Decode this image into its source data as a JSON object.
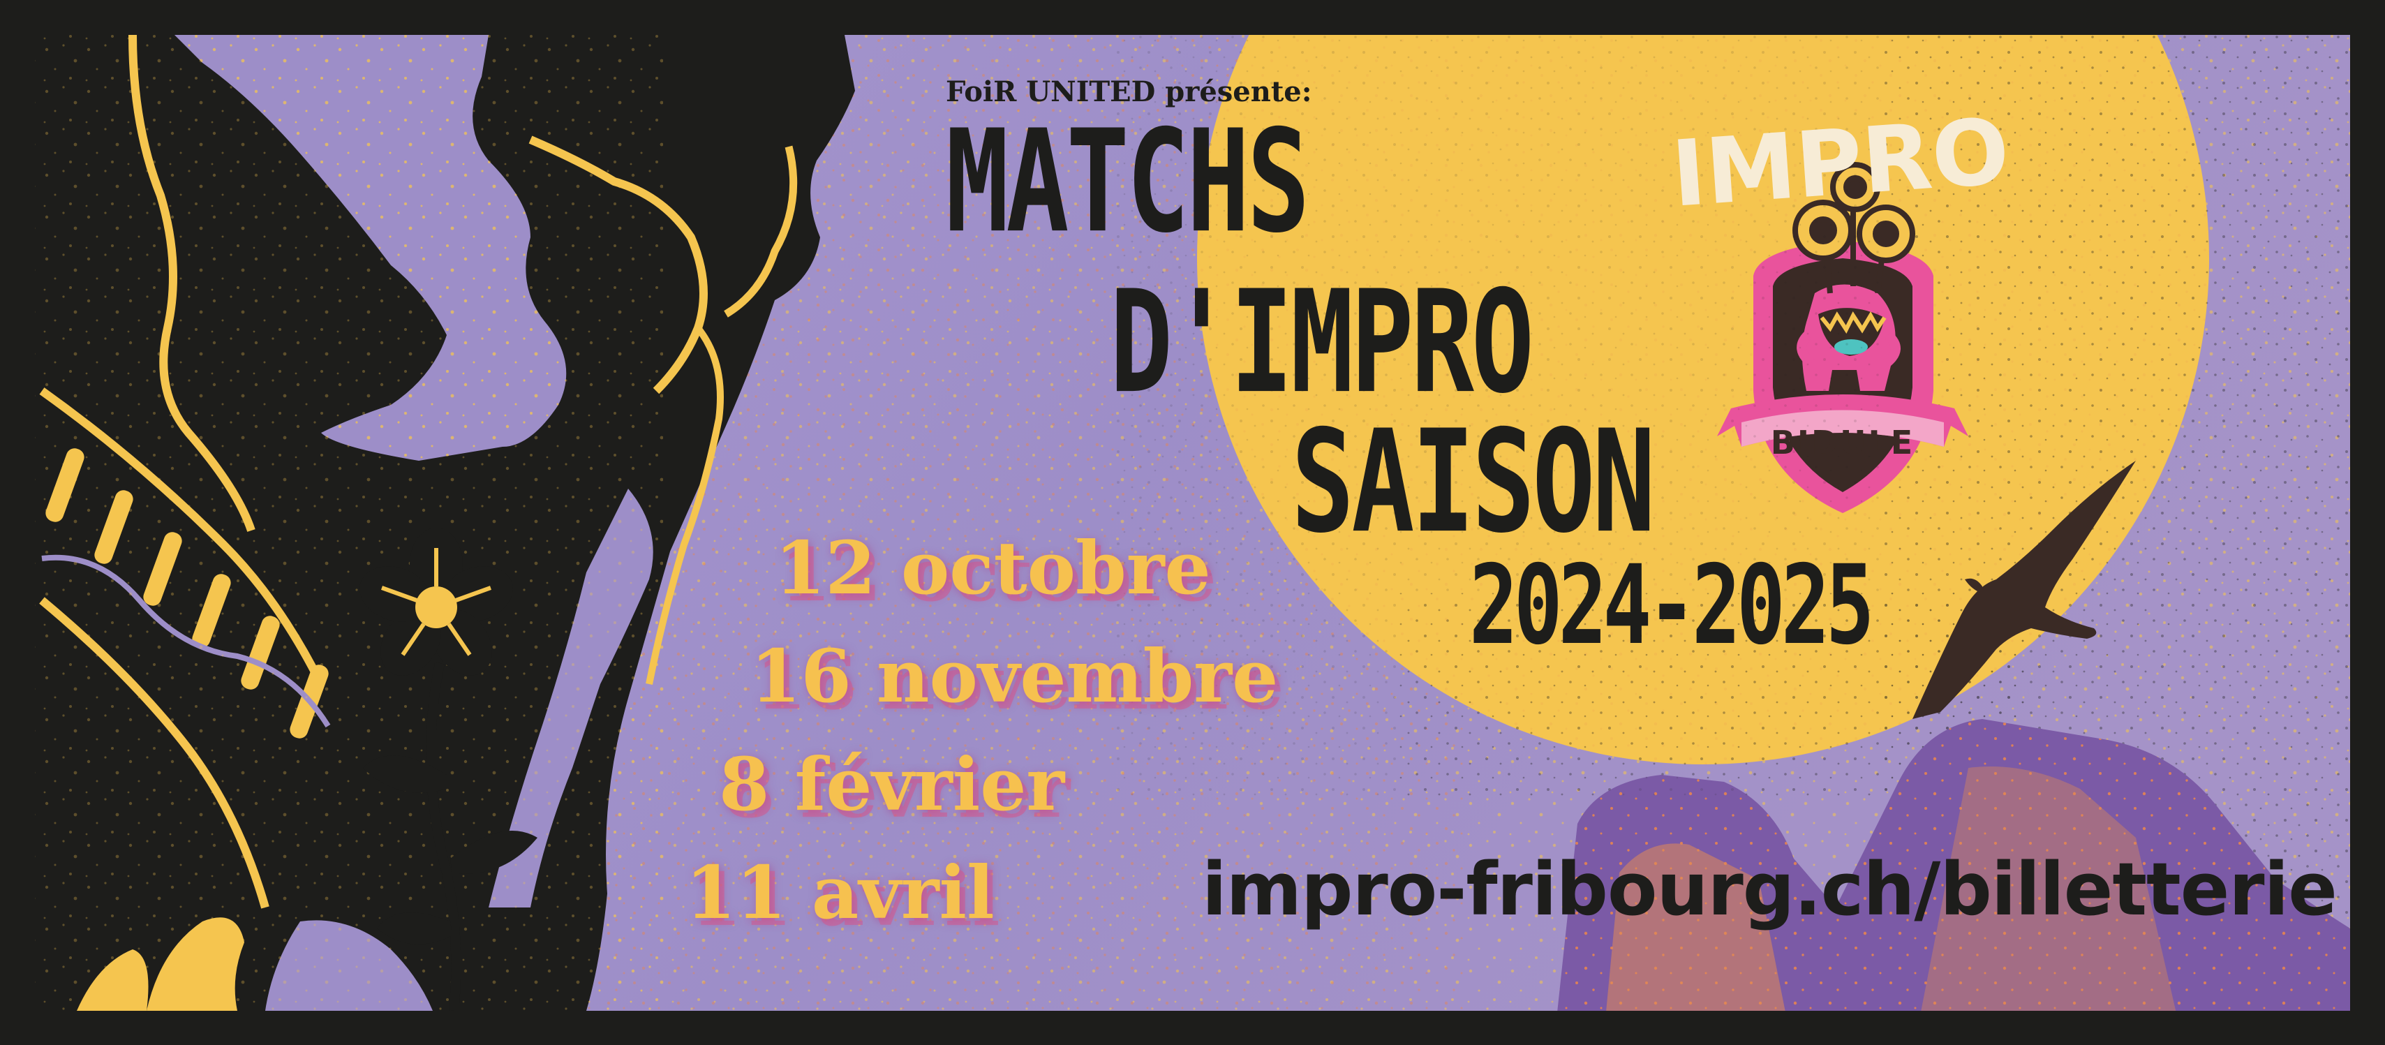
{
  "poster": {
    "presenter": "FoiR UNITED présente:",
    "title_lines": [
      "MATCHS",
      "D'IMPRO",
      "SAISON"
    ],
    "season": "2024-2025",
    "dates": [
      "12 octobre",
      "16 novembre",
      "8 février",
      "11 avril"
    ],
    "url": "impro-fribourg.ch/billetterie"
  },
  "logo": {
    "top_text": "IMPRO",
    "banner_text": "BIDULE"
  },
  "colors": {
    "background_lavender": "#9e8fc9",
    "sun_yellow": "#f5c54f",
    "ink_black": "#1d1d1b",
    "date_yellow": "#f6c14f",
    "date_shadow_pink": "#d4568c",
    "mountain_purple": "#7b5aa6",
    "mountain_orange": "#e28a55",
    "logo_pink": "#e9539c",
    "logo_cream": "#f7ecd6"
  },
  "decor": {
    "silhouette": "cowboy-silhouette",
    "flower": "flower-icon",
    "bird": "bird-icon",
    "mountains": "mountain-shapes",
    "sun": "sun-circle"
  }
}
